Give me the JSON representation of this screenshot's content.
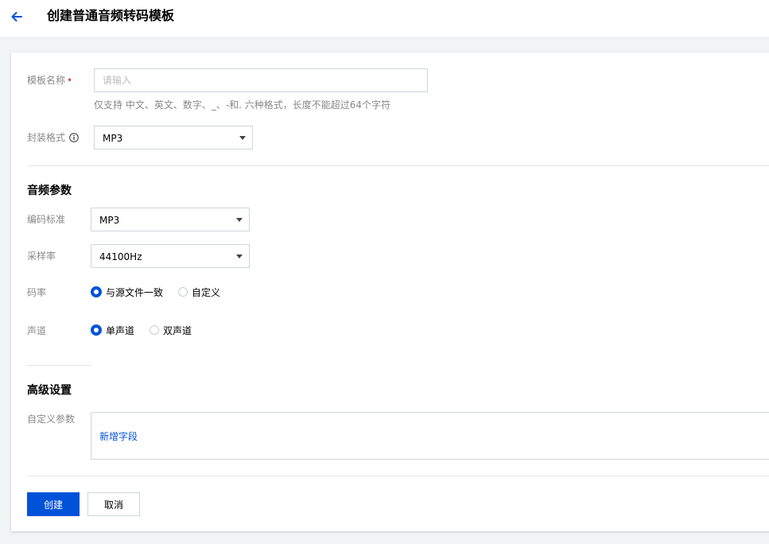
{
  "header": {
    "title": "创建普通音频转码模板"
  },
  "form": {
    "name": {
      "label": "模板名称",
      "required_mark": "•",
      "placeholder": "请输入",
      "value": "",
      "hint": "仅支持 中文、英文、数字、_、-和. 六种格式，长度不能超过64个字符"
    },
    "container": {
      "label": "封装格式",
      "value": "MP3"
    }
  },
  "audio": {
    "section_title": "音频参数",
    "codec": {
      "label": "编码标准",
      "value": "MP3"
    },
    "sample_rate": {
      "label": "采样率",
      "value": "44100Hz"
    },
    "bitrate": {
      "label": "码率",
      "options": [
        "与源文件一致",
        "自定义"
      ],
      "selected": "与源文件一致"
    },
    "channel": {
      "label": "声道",
      "options": [
        "单声道",
        "双声道"
      ],
      "selected": "单声道"
    }
  },
  "advanced": {
    "section_title": "高级设置",
    "custom_params_label": "自定义参数",
    "add_field_link": "新增字段"
  },
  "actions": {
    "create_label": "创建",
    "cancel_label": "取消"
  },
  "colors": {
    "primary": "#0052d9",
    "required": "#e54545",
    "background": "#f2f3f5"
  }
}
